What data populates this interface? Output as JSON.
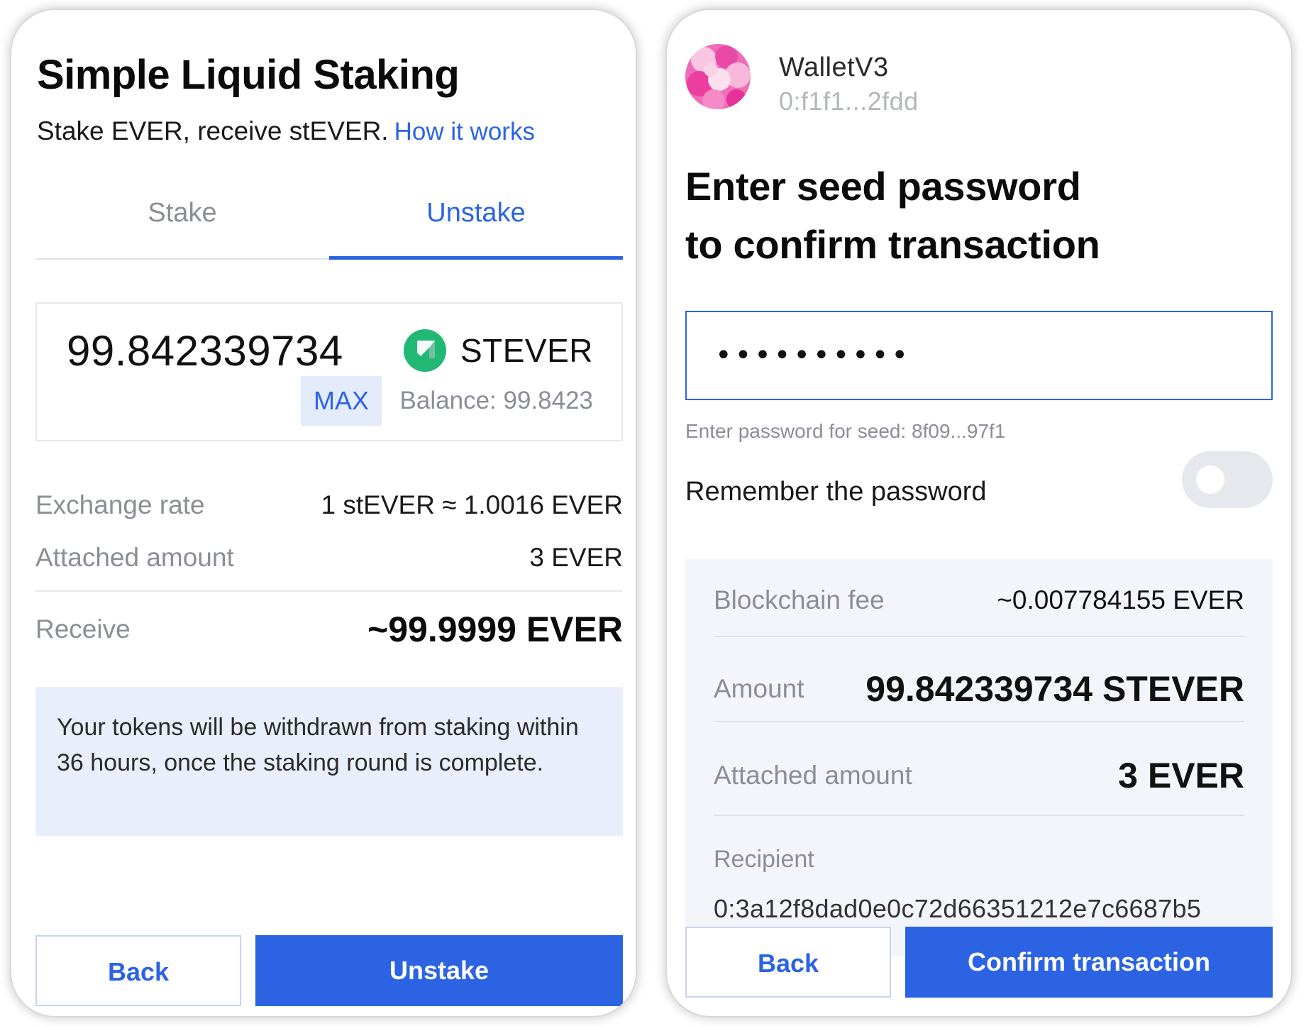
{
  "staking": {
    "title": "Simple Liquid Staking",
    "subtitle": "Stake EVER, receive stEVER.",
    "how_it_works": "How it works",
    "tabs": [
      {
        "label": "Stake",
        "active": false
      },
      {
        "label": "Unstake",
        "active": true
      }
    ],
    "amount": "99.842339734",
    "token": "STEVER",
    "token_icon": "stever-token-icon",
    "max_label": "MAX",
    "balance": "Balance: 99.8423",
    "exchange_rate_label": "Exchange rate",
    "exchange_rate_value": "1 stEVER ≈ 1.0016 EVER",
    "attached_amount_label": "Attached amount",
    "attached_amount_value": "3 EVER",
    "receive_label": "Receive",
    "receive_value": "~99.9999 EVER",
    "notice": "Your tokens will be withdrawn from staking within 36 hours, once the staking round is complete.",
    "back_label": "Back",
    "unstake_label": "Unstake"
  },
  "confirm": {
    "wallet_name": "WalletV3",
    "wallet_address": "0:f1f1...2fdd",
    "title_line1": "Enter seed password",
    "title_line2": "to confirm transaction",
    "password_value": "••••••••••",
    "password_hint": "Enter password for seed: 8f09...97f1",
    "remember_label": "Remember the password",
    "remember_enabled": false,
    "fee_label": "Blockchain fee",
    "fee_value": "~0.007784155 EVER",
    "amount_label": "Amount",
    "amount_value": "99.842339734 STEVER",
    "attached_label": "Attached amount",
    "attached_value": "3 EVER",
    "recipient_label": "Recipient",
    "recipient_value": "0:3a12f8dad0e0c72d66351212e7c6687b5",
    "back_label": "Back",
    "confirm_label": "Confirm transaction"
  },
  "colors": {
    "accent": "#2b63e3",
    "muted": "#8b8e95",
    "notice_bg": "#e9eefb",
    "token_green": "#21b874"
  }
}
